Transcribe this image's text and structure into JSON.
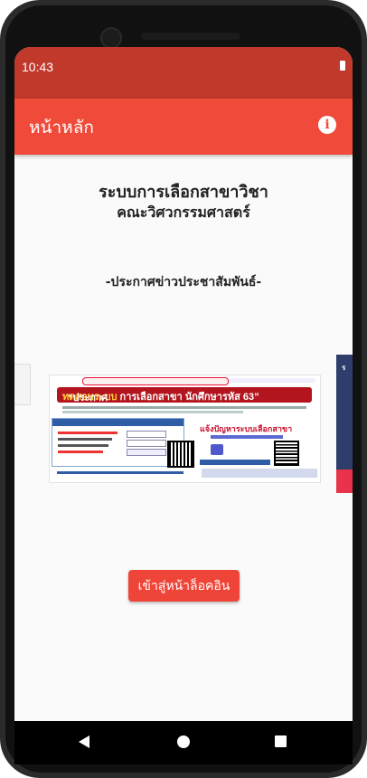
{
  "statusbar": {
    "time": "10:43"
  },
  "appbar": {
    "title": "หน้าหลัก",
    "info_icon": "info-icon"
  },
  "main": {
    "heading": "ระบบการเลือกสาขาวิชา",
    "subheading": "คณะวิศวกรรมศาสตร์",
    "news_label": "-ประกาศข่าวประชาสัมพันธ์-",
    "login_button": "เข้าสู่หน้าล็อคอิน"
  },
  "poster": {
    "banner_prefix": "“ประกาศ ",
    "banner_highlight": "ทดสอบระบบ",
    "banner_suffix": " การเลือกสาขา นักศึกษารหัส 63”",
    "right_heading": "แจ้งปัญหาระบบเลือกสาขา"
  },
  "navbar": {
    "back_icon": "back-icon",
    "home_icon": "home-icon",
    "recents_icon": "recents-icon"
  },
  "colors": {
    "statusbar": "#c0392b",
    "appbar": "#f04a3a",
    "button": "#ef4438",
    "background": "#fafafa"
  }
}
